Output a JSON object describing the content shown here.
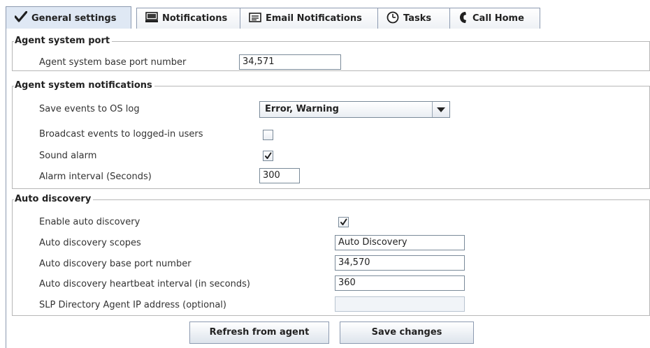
{
  "tabs": [
    {
      "label": "General settings",
      "icon": "checkmark-icon",
      "active": true
    },
    {
      "label": "Notifications",
      "icon": "computer-icon",
      "active": false
    },
    {
      "label": "Email Notifications",
      "icon": "email-icon",
      "active": false
    },
    {
      "label": "Tasks",
      "icon": "clock-icon",
      "active": false
    },
    {
      "label": "Call Home",
      "icon": "phone-icon",
      "active": false
    }
  ],
  "agent_system_port": {
    "title": "Agent system port",
    "base_port_label": "Agent system base port number",
    "base_port_value": "34,571"
  },
  "agent_system_notifications": {
    "title": "Agent system notifications",
    "save_events_label": "Save events to OS log",
    "save_events_value": "Error, Warning",
    "broadcast_label": "Broadcast events to logged-in users",
    "broadcast_checked": false,
    "sound_alarm_label": "Sound alarm",
    "sound_alarm_checked": true,
    "alarm_interval_label": "Alarm interval (Seconds)",
    "alarm_interval_value": "300"
  },
  "auto_discovery": {
    "title": "Auto discovery",
    "enable_label": "Enable auto discovery",
    "enable_checked": true,
    "scopes_label": "Auto discovery scopes",
    "scopes_value": "Auto Discovery",
    "base_port_label": "Auto discovery base port number",
    "base_port_value": "34,570",
    "heartbeat_label": "Auto discovery heartbeat interval (in seconds)",
    "heartbeat_value": "360",
    "slp_label": "SLP Directory Agent IP address (optional)",
    "slp_value": ""
  },
  "actions": {
    "refresh_label": "Refresh from agent",
    "save_label": "Save changes"
  },
  "colors": {
    "tab_border": "#8c9ab0",
    "active_tab_bg": "#dfe8f4",
    "check_color": "#1f1f1f"
  }
}
